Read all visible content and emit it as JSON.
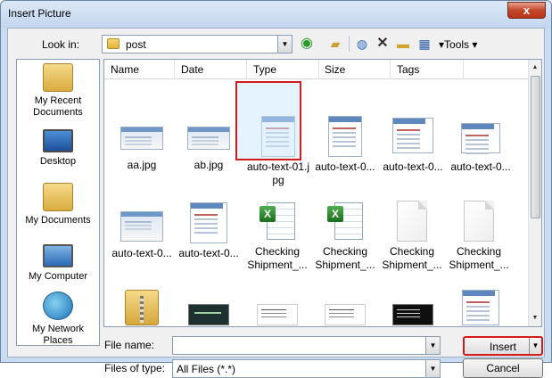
{
  "window": {
    "title": "Insert Picture",
    "close_glyph": "x"
  },
  "toolbar": {
    "look_in_label": "Look in:",
    "look_in_value": "post",
    "tools_label": "Tools"
  },
  "places": [
    {
      "label": "My Recent Documents",
      "icon": "recent-documents-icon"
    },
    {
      "label": "Desktop",
      "icon": "desktop-icon"
    },
    {
      "label": "My Documents",
      "icon": "my-documents-icon"
    },
    {
      "label": "My Computer",
      "icon": "my-computer-icon"
    },
    {
      "label": "My Network Places",
      "icon": "network-places-icon"
    }
  ],
  "columns": [
    "Name",
    "Date",
    "Type",
    "Size",
    "Tags"
  ],
  "files": [
    {
      "name": "aa.jpg",
      "thumb": "screenshot"
    },
    {
      "name": "ab.jpg",
      "thumb": "screenshot"
    },
    {
      "name": "auto-text-01.jpg",
      "thumb": "screenshot-tall",
      "selected": true
    },
    {
      "name": "auto-text-0...",
      "thumb": "screenshot-tall"
    },
    {
      "name": "auto-text-0...",
      "thumb": "screenshot-tall"
    },
    {
      "name": "auto-text-0...",
      "thumb": "screenshot-tall"
    },
    {
      "name": "auto-text-0...",
      "thumb": "screenshot"
    },
    {
      "name": "auto-text-0...",
      "thumb": "screenshot-tall"
    },
    {
      "name": "Checking Shipment_...",
      "thumb": "excel"
    },
    {
      "name": "Checking Shipment_...",
      "thumb": "excel"
    },
    {
      "name": "Checking Shipment_...",
      "thumb": "document"
    },
    {
      "name": "Checking Shipment_...",
      "thumb": "document"
    },
    {
      "name": "",
      "thumb": "zip-folder"
    },
    {
      "name": "",
      "thumb": "dark-screenshot"
    },
    {
      "name": "",
      "thumb": "text-screenshot"
    },
    {
      "name": "",
      "thumb": "text-screenshot"
    },
    {
      "name": "",
      "thumb": "console-screenshot"
    },
    {
      "name": "",
      "thumb": "screenshot-tall"
    }
  ],
  "file_name": {
    "label": "File name:",
    "value": ""
  },
  "files_of_type": {
    "label": "Files of type:",
    "value": "All Files (*.*)"
  },
  "buttons": {
    "insert": "Insert",
    "cancel": "Cancel"
  }
}
